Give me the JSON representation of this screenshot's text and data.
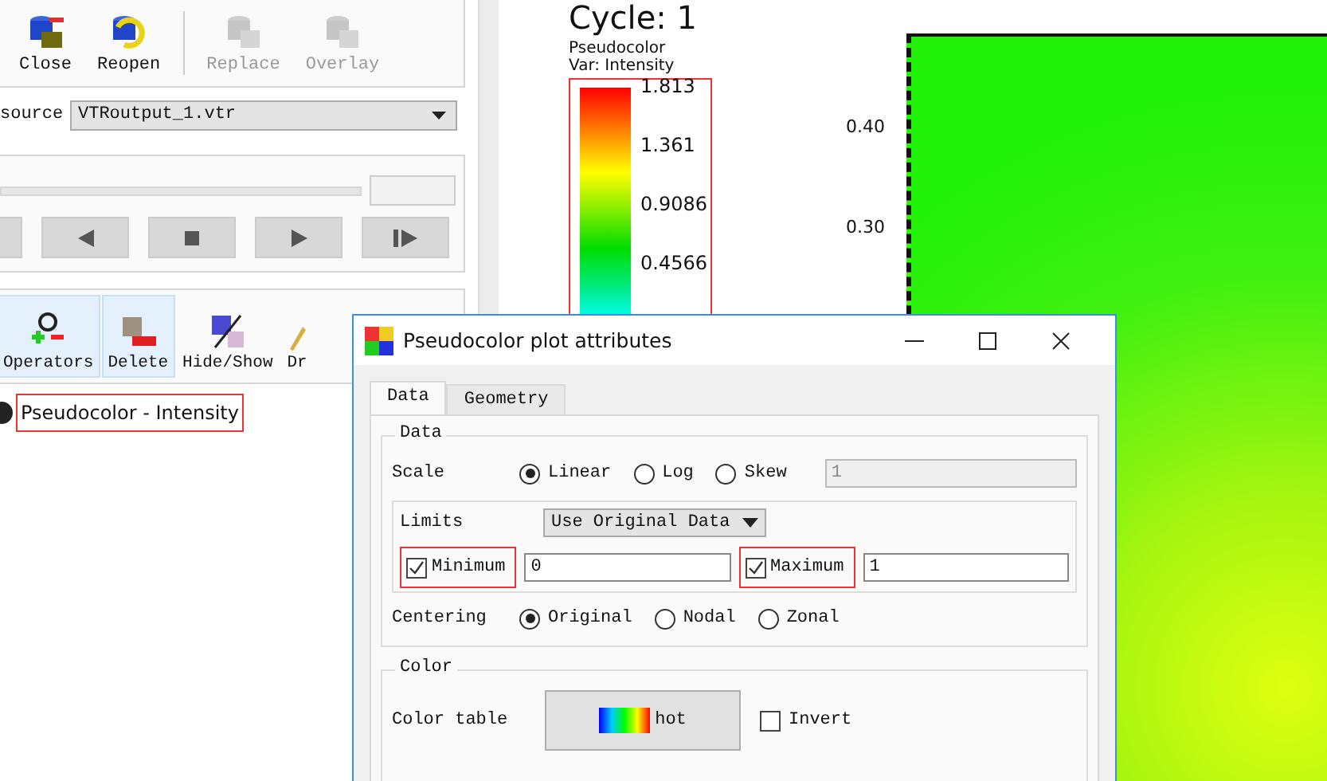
{
  "main_window": {
    "toolbar": [
      {
        "label": "Close",
        "kind": "close",
        "disabled": false
      },
      {
        "label": "Reopen",
        "kind": "reopen",
        "disabled": false
      },
      {
        "label": "Replace",
        "kind": "replace",
        "disabled": true
      },
      {
        "label": "Overlay",
        "kind": "overlay",
        "disabled": true
      }
    ],
    "source": {
      "label": "source",
      "value": "VTRoutput_1.vtr"
    },
    "time_slider": {
      "level": 0
    },
    "playback_buttons": [
      {
        "kind": "partial"
      },
      {
        "kind": "reverse"
      },
      {
        "kind": "stop"
      },
      {
        "kind": "play"
      },
      {
        "kind": "step"
      }
    ],
    "plot_toolbar": [
      {
        "label": "Operators",
        "kind": "operators",
        "highlighted": true
      },
      {
        "label": "Delete",
        "kind": "delete",
        "highlighted": true
      },
      {
        "label": "Hide/Show",
        "kind": "hideshow",
        "highlighted": false
      },
      {
        "label": "Dr",
        "kind": "draw",
        "highlighted": false
      }
    ],
    "plots": [
      {
        "label": "Pseudocolor - Intensity",
        "annotated": true
      }
    ]
  },
  "viewer": {
    "title": "Cycle: 1",
    "legend": {
      "title": "Pseudocolor",
      "variable": "Var: Intensity",
      "annotated": true,
      "ticks": [
        "1.813",
        "1.361",
        "0.9086",
        "0.4566"
      ]
    },
    "axis_labels": [
      "0.40",
      "0.30"
    ]
  },
  "dialog": {
    "title": "Pseudocolor plot attributes",
    "tabs": [
      {
        "label": "Data",
        "selected": true
      },
      {
        "label": "Geometry",
        "selected": false
      }
    ],
    "data_group": {
      "title": "Data",
      "scale_label": "Scale",
      "scale_options": [
        {
          "label": "Linear",
          "selected": true
        },
        {
          "label": "Log",
          "selected": false
        },
        {
          "label": "Skew",
          "selected": false
        }
      ],
      "skew_value": "1",
      "limits_label": "Limits",
      "limits_mode": "Use Original Data",
      "minimum": {
        "label": "Minimum",
        "checked": true,
        "annotated": true,
        "value": "0"
      },
      "maximum": {
        "label": "Maximum",
        "checked": true,
        "annotated": true,
        "value": "1"
      },
      "centering_label": "Centering",
      "centering_options": [
        {
          "label": "Original",
          "selected": true
        },
        {
          "label": "Nodal",
          "selected": false
        },
        {
          "label": "Zonal",
          "selected": false
        }
      ]
    },
    "color_group": {
      "title": "Color",
      "table_label": "Color table",
      "table_value": "hot",
      "invert": {
        "label": "Invert",
        "checked": false
      }
    }
  }
}
